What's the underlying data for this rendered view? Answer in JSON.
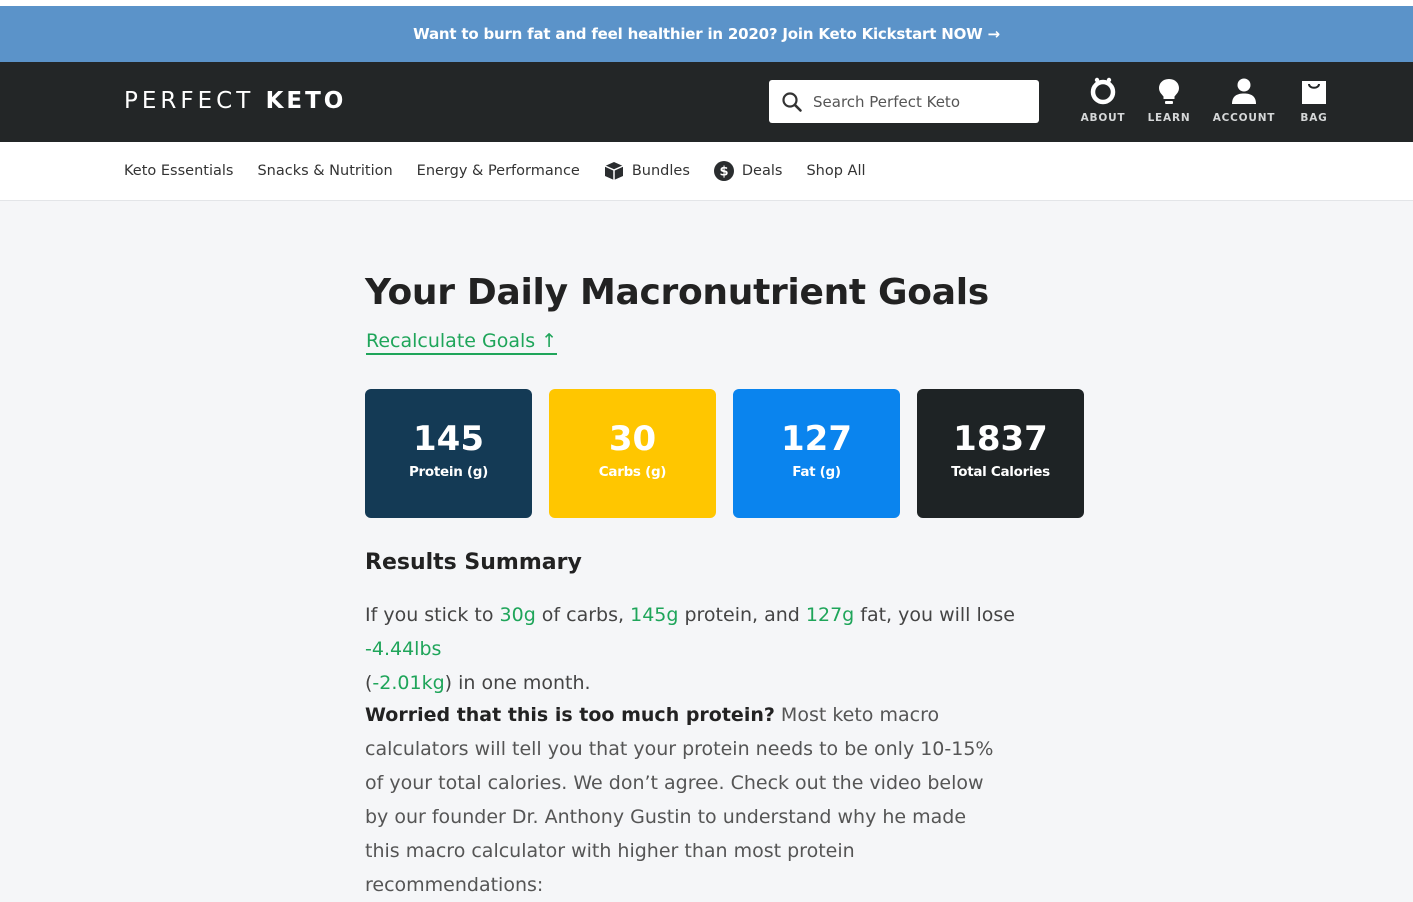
{
  "promo": {
    "text": "Want to burn fat and feel healthier in 2020? Join Keto Kickstart NOW →"
  },
  "header": {
    "logo_light": "PERFECT",
    "logo_bold": "KETO",
    "search_placeholder": "Search Perfect Keto",
    "nav": [
      {
        "label": "ABOUT",
        "icon": "about-icon"
      },
      {
        "label": "LEARN",
        "icon": "lightbulb-icon"
      },
      {
        "label": "ACCOUNT",
        "icon": "user-icon"
      },
      {
        "label": "BAG",
        "icon": "bag-icon"
      }
    ]
  },
  "subnav": {
    "items": [
      {
        "label": "Keto Essentials"
      },
      {
        "label": "Snacks & Nutrition"
      },
      {
        "label": "Energy & Performance"
      },
      {
        "label": "Bundles",
        "icon": "box-icon"
      },
      {
        "label": "Deals",
        "icon": "dollar-icon"
      },
      {
        "label": "Shop All"
      }
    ]
  },
  "main": {
    "title": "Your Daily Macronutrient Goals",
    "recalc_label": "Recalculate Goals ↑",
    "cards": [
      {
        "value": "145",
        "label": "Protein (g)",
        "color": "#143a55"
      },
      {
        "value": "30",
        "label": "Carbs (g)",
        "color": "#ffc600"
      },
      {
        "value": "127",
        "label": "Fat (g)",
        "color": "#0a84ee"
      },
      {
        "value": "1837",
        "label": "Total Calories",
        "color": "#1e2325"
      }
    ],
    "summary_heading": "Results Summary",
    "summary": {
      "t1": "If you stick to ",
      "carbs": "30g",
      "t2": " of carbs, ",
      "protein": "145g",
      "t3": " protein, and ",
      "fat": "127g",
      "t4": " fat, you will lose ",
      "lbs": "-4.44lbs",
      "t5": " (",
      "kg": "-2.01kg",
      "t6": ") in one month."
    },
    "worry_bold": "Worried that this is too much protein?",
    "worry_text": " Most keto macro calculators will tell you that your protein needs to be only 10-15% of your total calories. We don’t agree. Check out the video below by our founder Dr. Anthony Gustin to understand why he made this macro calculator with higher than most protein recommendations:"
  },
  "colors": {
    "accent": "#1fa55a",
    "promo_bg": "#5b93c9",
    "header_bg": "#232627"
  }
}
